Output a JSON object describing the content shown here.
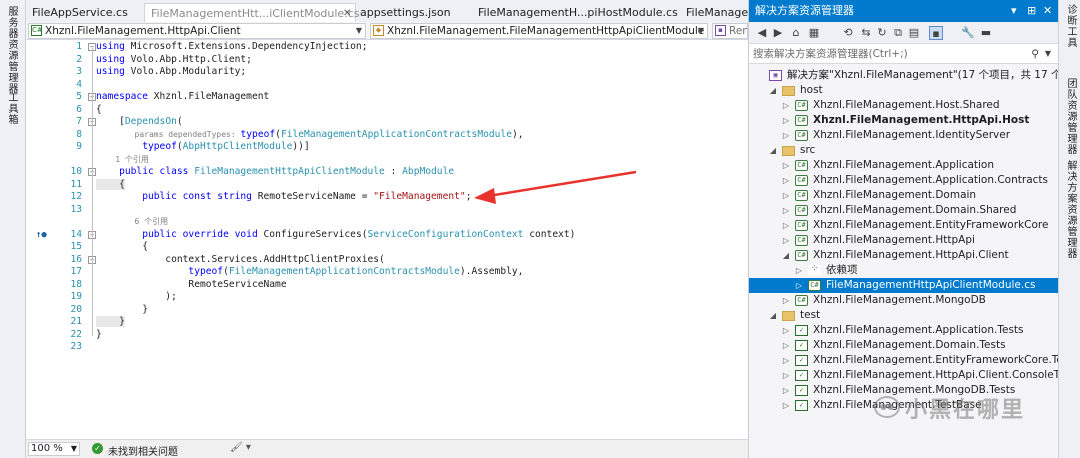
{
  "left_strip": {
    "tab_server_explorer": "服务器资源管理器",
    "tab_toolbox": "工具箱"
  },
  "right_strip": {
    "tab_diagnostics": "诊断工具",
    "tab_team_explorer": "团队资源管理器",
    "tab_solution_explorer": "解决方案资源管理器"
  },
  "tabs": [
    {
      "label": "FileAppService.cs"
    },
    {
      "label": "FileManagementHtt...iClientModule.cs"
    },
    {
      "label": "appsettings.json"
    },
    {
      "label": "FileManagementH...piHostModule.cs"
    },
    {
      "label": "FileManagem"
    }
  ],
  "navbar": {
    "project": "Xhznl.FileManagement.HttpApi.Client",
    "class": "Xhznl.FileManagement.FileManagementHttpApiClientModule",
    "member": "Ren"
  },
  "code": {
    "lines": [
      {
        "n": "1",
        "parts": [
          [
            "k",
            "using"
          ],
          [
            "p",
            " Microsoft.Extensions.DependencyInjection;"
          ]
        ]
      },
      {
        "n": "2",
        "parts": [
          [
            "k",
            "using"
          ],
          [
            "p",
            " Volo.Abp.Http.Client;"
          ]
        ]
      },
      {
        "n": "3",
        "parts": [
          [
            "k",
            "using"
          ],
          [
            "p",
            " Volo.Abp.Modularity;"
          ]
        ]
      },
      {
        "n": "4",
        "parts": []
      },
      {
        "n": "5",
        "parts": [
          [
            "k",
            "namespace"
          ],
          [
            "p",
            " Xhznl.FileManagement"
          ]
        ]
      },
      {
        "n": "6",
        "parts": [
          [
            "p",
            "{"
          ]
        ]
      },
      {
        "n": "7",
        "parts": [
          [
            "p",
            "    ["
          ],
          [
            "t",
            "DependsOn"
          ],
          [
            "p",
            "("
          ]
        ]
      },
      {
        "n": "8",
        "parts": [
          [
            "h",
            "        params dependedTypes: "
          ],
          [
            "k",
            "typeof"
          ],
          [
            "p",
            "("
          ],
          [
            "t",
            "FileManagementApplicationContractsModule"
          ],
          [
            "p",
            "),"
          ]
        ]
      },
      {
        "n": "9",
        "parts": [
          [
            "p",
            "        "
          ],
          [
            "k",
            "typeof"
          ],
          [
            "p",
            "("
          ],
          [
            "t",
            "AbpHttpClientModule"
          ],
          [
            "p",
            "))]"
          ]
        ]
      },
      {
        "n": "",
        "parts": [
          [
            "h2",
            "    1 个引用"
          ]
        ]
      },
      {
        "n": "10",
        "parts": [
          [
            "p",
            "    "
          ],
          [
            "k",
            "public class"
          ],
          [
            "p",
            " "
          ],
          [
            "t",
            "FileManagementHttpApiClientModule"
          ],
          [
            "p",
            " : "
          ],
          [
            "t",
            "AbpModule"
          ]
        ]
      },
      {
        "n": "11",
        "parts": [
          [
            "b",
            "    {"
          ]
        ]
      },
      {
        "n": "12",
        "parts": [
          [
            "p",
            "        "
          ],
          [
            "k",
            "public const string"
          ],
          [
            "p",
            " RemoteServiceName = "
          ],
          [
            "s",
            "\"FileManagement\""
          ],
          [
            "p",
            ";"
          ]
        ]
      },
      {
        "n": "13",
        "parts": []
      },
      {
        "n": "",
        "parts": [
          [
            "h2",
            "        6 个引用"
          ]
        ]
      },
      {
        "n": "14",
        "parts": [
          [
            "p",
            "        "
          ],
          [
            "k",
            "public override void"
          ],
          [
            "p",
            " ConfigureServices("
          ],
          [
            "t",
            "ServiceConfigurationContext"
          ],
          [
            "p",
            " context)"
          ]
        ]
      },
      {
        "n": "15",
        "parts": [
          [
            "p",
            "        {"
          ]
        ]
      },
      {
        "n": "16",
        "parts": [
          [
            "p",
            "            context.Services.AddHttpClientProxies("
          ]
        ]
      },
      {
        "n": "17",
        "parts": [
          [
            "p",
            "                "
          ],
          [
            "k",
            "typeof"
          ],
          [
            "p",
            "("
          ],
          [
            "t",
            "FileManagementApplicationContractsModule"
          ],
          [
            "p",
            ").Assembly,"
          ]
        ]
      },
      {
        "n": "18",
        "parts": [
          [
            "p",
            "                RemoteServiceName"
          ]
        ]
      },
      {
        "n": "19",
        "parts": [
          [
            "p",
            "            );"
          ]
        ]
      },
      {
        "n": "20",
        "parts": [
          [
            "p",
            "        }"
          ]
        ]
      },
      {
        "n": "21",
        "parts": [
          [
            "b",
            "    }"
          ]
        ]
      },
      {
        "n": "22",
        "parts": [
          [
            "p",
            "}"
          ]
        ]
      },
      {
        "n": "23",
        "parts": []
      }
    ]
  },
  "status": {
    "zoom": "100 %",
    "issues": "未找到相关问题"
  },
  "solution_explorer": {
    "title": "解决方案资源管理器",
    "search_placeholder": "搜索解决方案资源管理器(Ctrl+;)",
    "items": [
      {
        "label": "解决方案\"Xhznl.FileManagement\"(17 个项目，共 17 个)",
        "level": 0,
        "icon": "sln",
        "exp": "",
        "bold": false,
        "selected": false
      },
      {
        "label": "host",
        "level": 1,
        "icon": "folder",
        "exp": "◢",
        "bold": false,
        "selected": false
      },
      {
        "label": "Xhznl.FileManagement.Host.Shared",
        "level": 2,
        "icon": "cs",
        "exp": "▷",
        "bold": false,
        "selected": false
      },
      {
        "label": "Xhznl.FileManagement.HttpApi.Host",
        "level": 2,
        "icon": "cs",
        "exp": "▷",
        "bold": true,
        "selected": false
      },
      {
        "label": "Xhznl.FileManagement.IdentityServer",
        "level": 2,
        "icon": "cs",
        "exp": "▷",
        "bold": false,
        "selected": false
      },
      {
        "label": "src",
        "level": 1,
        "icon": "folder",
        "exp": "◢",
        "bold": false,
        "selected": false
      },
      {
        "label": "Xhznl.FileManagement.Application",
        "level": 2,
        "icon": "cs",
        "exp": "▷",
        "bold": false,
        "selected": false
      },
      {
        "label": "Xhznl.FileManagement.Application.Contracts",
        "level": 2,
        "icon": "cs",
        "exp": "▷",
        "bold": false,
        "selected": false
      },
      {
        "label": "Xhznl.FileManagement.Domain",
        "level": 2,
        "icon": "cs",
        "exp": "▷",
        "bold": false,
        "selected": false
      },
      {
        "label": "Xhznl.FileManagement.Domain.Shared",
        "level": 2,
        "icon": "cs",
        "exp": "▷",
        "bold": false,
        "selected": false
      },
      {
        "label": "Xhznl.FileManagement.EntityFrameworkCore",
        "level": 2,
        "icon": "cs",
        "exp": "▷",
        "bold": false,
        "selected": false
      },
      {
        "label": "Xhznl.FileManagement.HttpApi",
        "level": 2,
        "icon": "cs",
        "exp": "▷",
        "bold": false,
        "selected": false
      },
      {
        "label": "Xhznl.FileManagement.HttpApi.Client",
        "level": 2,
        "icon": "cs",
        "exp": "◢",
        "bold": false,
        "selected": false
      },
      {
        "label": "依赖项",
        "level": 3,
        "icon": "dep",
        "exp": "▷",
        "bold": false,
        "selected": false
      },
      {
        "label": "FileManagementHttpApiClientModule.cs",
        "level": 3,
        "icon": "cs",
        "exp": "▷",
        "bold": false,
        "selected": true
      },
      {
        "label": "Xhznl.FileManagement.MongoDB",
        "level": 2,
        "icon": "cs",
        "exp": "▷",
        "bold": false,
        "selected": false
      },
      {
        "label": "test",
        "level": 1,
        "icon": "folder",
        "exp": "◢",
        "bold": false,
        "selected": false
      },
      {
        "label": "Xhznl.FileManagement.Application.Tests",
        "level": 2,
        "icon": "test",
        "exp": "▷",
        "bold": false,
        "selected": false
      },
      {
        "label": "Xhznl.FileManagement.Domain.Tests",
        "level": 2,
        "icon": "test",
        "exp": "▷",
        "bold": false,
        "selected": false
      },
      {
        "label": "Xhznl.FileManagement.EntityFrameworkCore.Tests",
        "level": 2,
        "icon": "test",
        "exp": "▷",
        "bold": false,
        "selected": false
      },
      {
        "label": "Xhznl.FileManagement.HttpApi.Client.ConsoleTestApp",
        "level": 2,
        "icon": "test",
        "exp": "▷",
        "bold": false,
        "selected": false
      },
      {
        "label": "Xhznl.FileManagement.MongoDB.Tests",
        "level": 2,
        "icon": "test",
        "exp": "▷",
        "bold": false,
        "selected": false
      },
      {
        "label": "Xhznl.FileManagement.TestBase",
        "level": 2,
        "icon": "test",
        "exp": "▷",
        "bold": false,
        "selected": false
      }
    ]
  },
  "watermark": "小黑在哪里",
  "colors": {
    "accent": "#007acc",
    "keyword": "#0000ff",
    "type": "#2b91af",
    "string": "#a31515",
    "arrow": "#e8322b"
  }
}
